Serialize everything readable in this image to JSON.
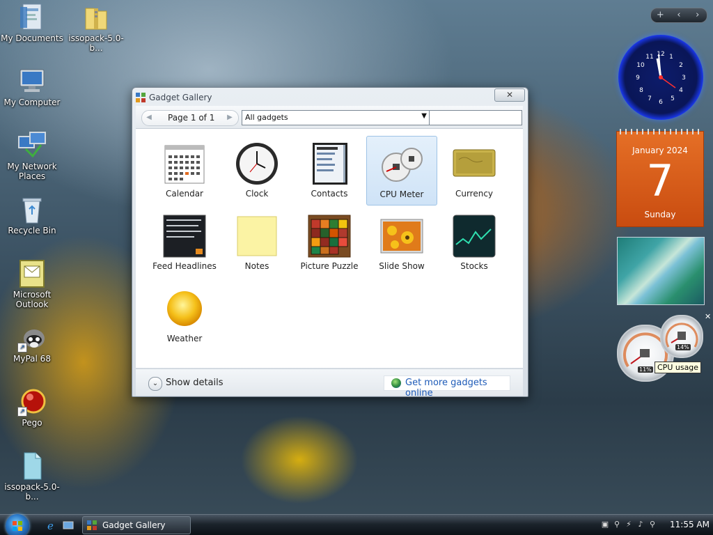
{
  "desktop": {
    "icons": [
      {
        "label": "My Documents"
      },
      {
        "label": "issopack-5.0-b..."
      },
      {
        "label": "My Computer"
      },
      {
        "label": "My Network Places"
      },
      {
        "label": "Recycle Bin"
      },
      {
        "label": "Microsoft Outlook"
      },
      {
        "label": "MyPal 68"
      },
      {
        "label": "Pego"
      },
      {
        "label": "issopack-5.0-b..."
      }
    ]
  },
  "gadget_toolbar": {
    "add": "+",
    "prev": "‹",
    "next": "›"
  },
  "dialog": {
    "title": "Gadget Gallery",
    "close": "✕",
    "pager": {
      "text": "Page 1 of 1",
      "prev": "◀",
      "next": "▶"
    },
    "filter": {
      "value": "All gadgets",
      "arrow": "▼"
    },
    "search_value": "",
    "gadgets": [
      {
        "name": "Calendar"
      },
      {
        "name": "Clock"
      },
      {
        "name": "Contacts"
      },
      {
        "name": "CPU Meter"
      },
      {
        "name": "Currency"
      },
      {
        "name": "Feed Headlines"
      },
      {
        "name": "Notes"
      },
      {
        "name": "Picture Puzzle"
      },
      {
        "name": "Slide Show"
      },
      {
        "name": "Stocks"
      },
      {
        "name": "Weather"
      }
    ],
    "selected": "CPU Meter",
    "details_label": "Show details",
    "details_icon": "⌄",
    "online_label": "Get more gadgets online"
  },
  "sidebar": {
    "calendar": {
      "month_year": "January 2024",
      "day": "7",
      "weekday": "Sunday"
    },
    "cpu": {
      "cpu_percent": "11%",
      "mem_percent": "14%",
      "close": "✕"
    },
    "tooltip": "CPU usage"
  },
  "taskbar": {
    "task_label": "Gadget Gallery",
    "time": "11:55 AM"
  },
  "colors": {
    "accent": "#1e5bb8",
    "calendar": "#d95a18",
    "selection": "#cfe3f7"
  }
}
